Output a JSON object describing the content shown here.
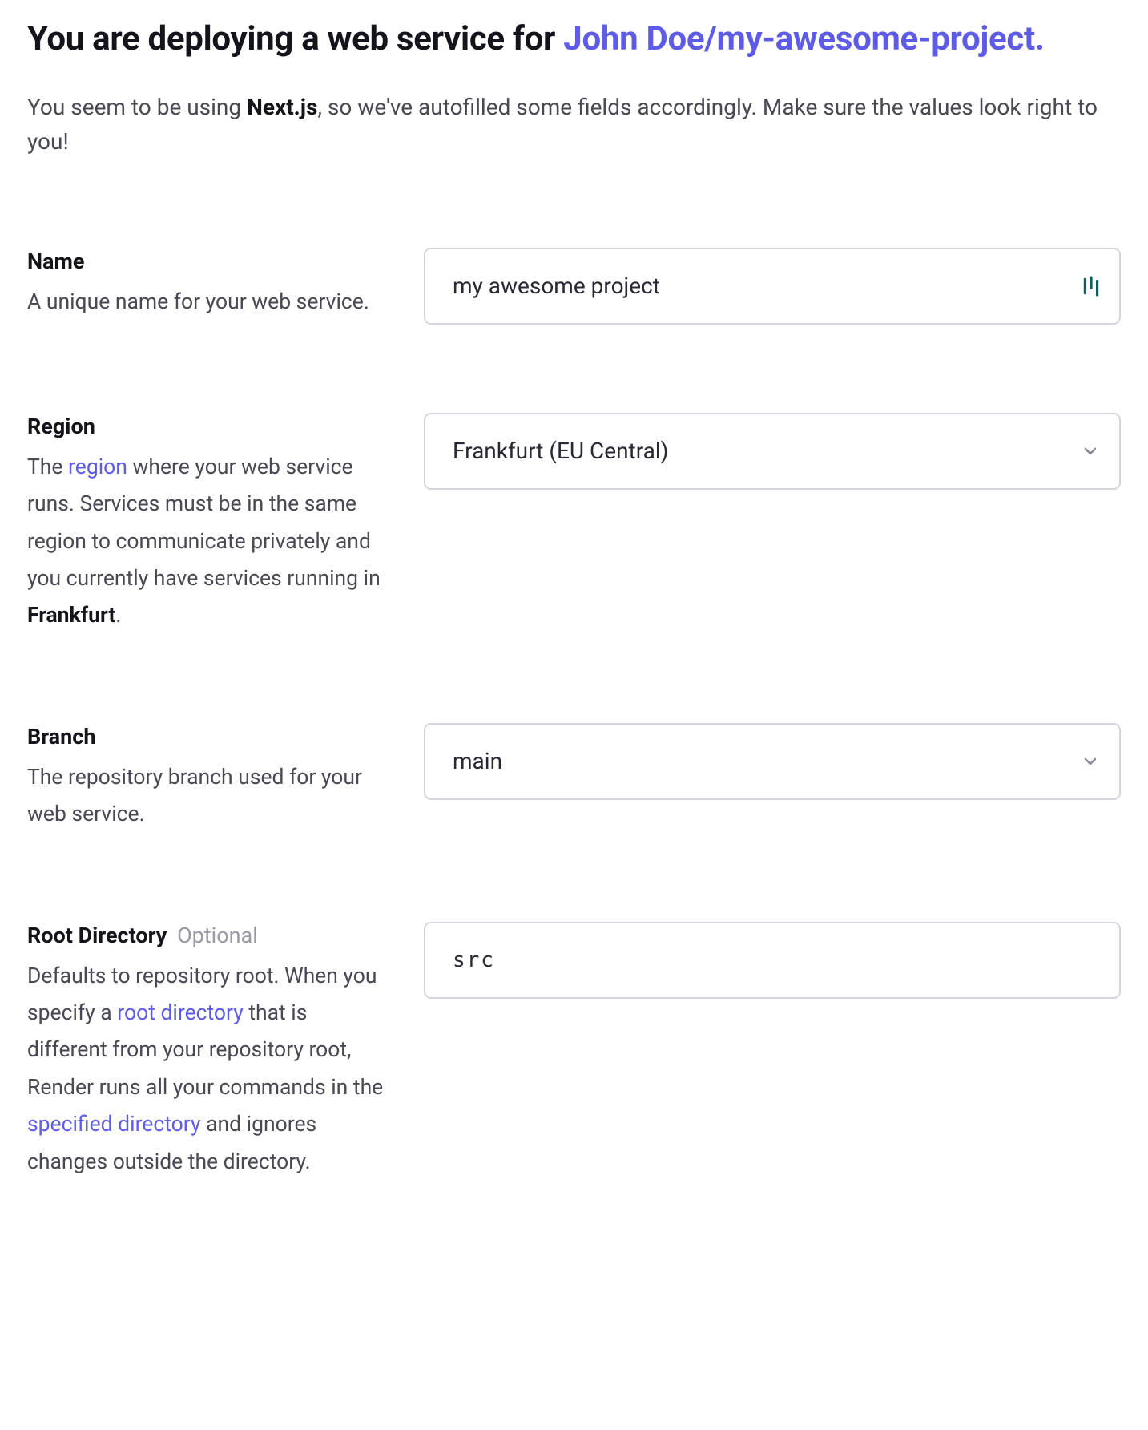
{
  "heading": {
    "prefix": "You are deploying a web service for ",
    "repo": "John Doe/my-awesome-project."
  },
  "intro": {
    "pre": "You seem to be using ",
    "framework": "Next.js",
    "post": ", so we've autofilled some fields accordingly. Make sure the values look right to you!"
  },
  "fields": {
    "name": {
      "label": "Name",
      "desc": "A unique name for your web service.",
      "value": "my awesome project"
    },
    "region": {
      "label": "Region",
      "desc_pre": "The ",
      "desc_link": "region",
      "desc_mid": " where your web service runs. Services must be in the same region to communicate privately and you currently have services running in ",
      "desc_bold": "Frankfurt",
      "desc_post": ".",
      "value": "Frankfurt (EU Central)"
    },
    "branch": {
      "label": "Branch",
      "desc": "The repository branch used for your web service.",
      "value": "main"
    },
    "rootdir": {
      "label": "Root Directory",
      "optional": "Optional",
      "desc_pre": "Defaults to repository root. When you specify a ",
      "desc_link1": "root directory",
      "desc_mid": " that is different from your repository root, Render runs all your commands in the ",
      "desc_link2": "specified directory",
      "desc_post": " and ignores changes outside the directory.",
      "value": "src"
    }
  }
}
